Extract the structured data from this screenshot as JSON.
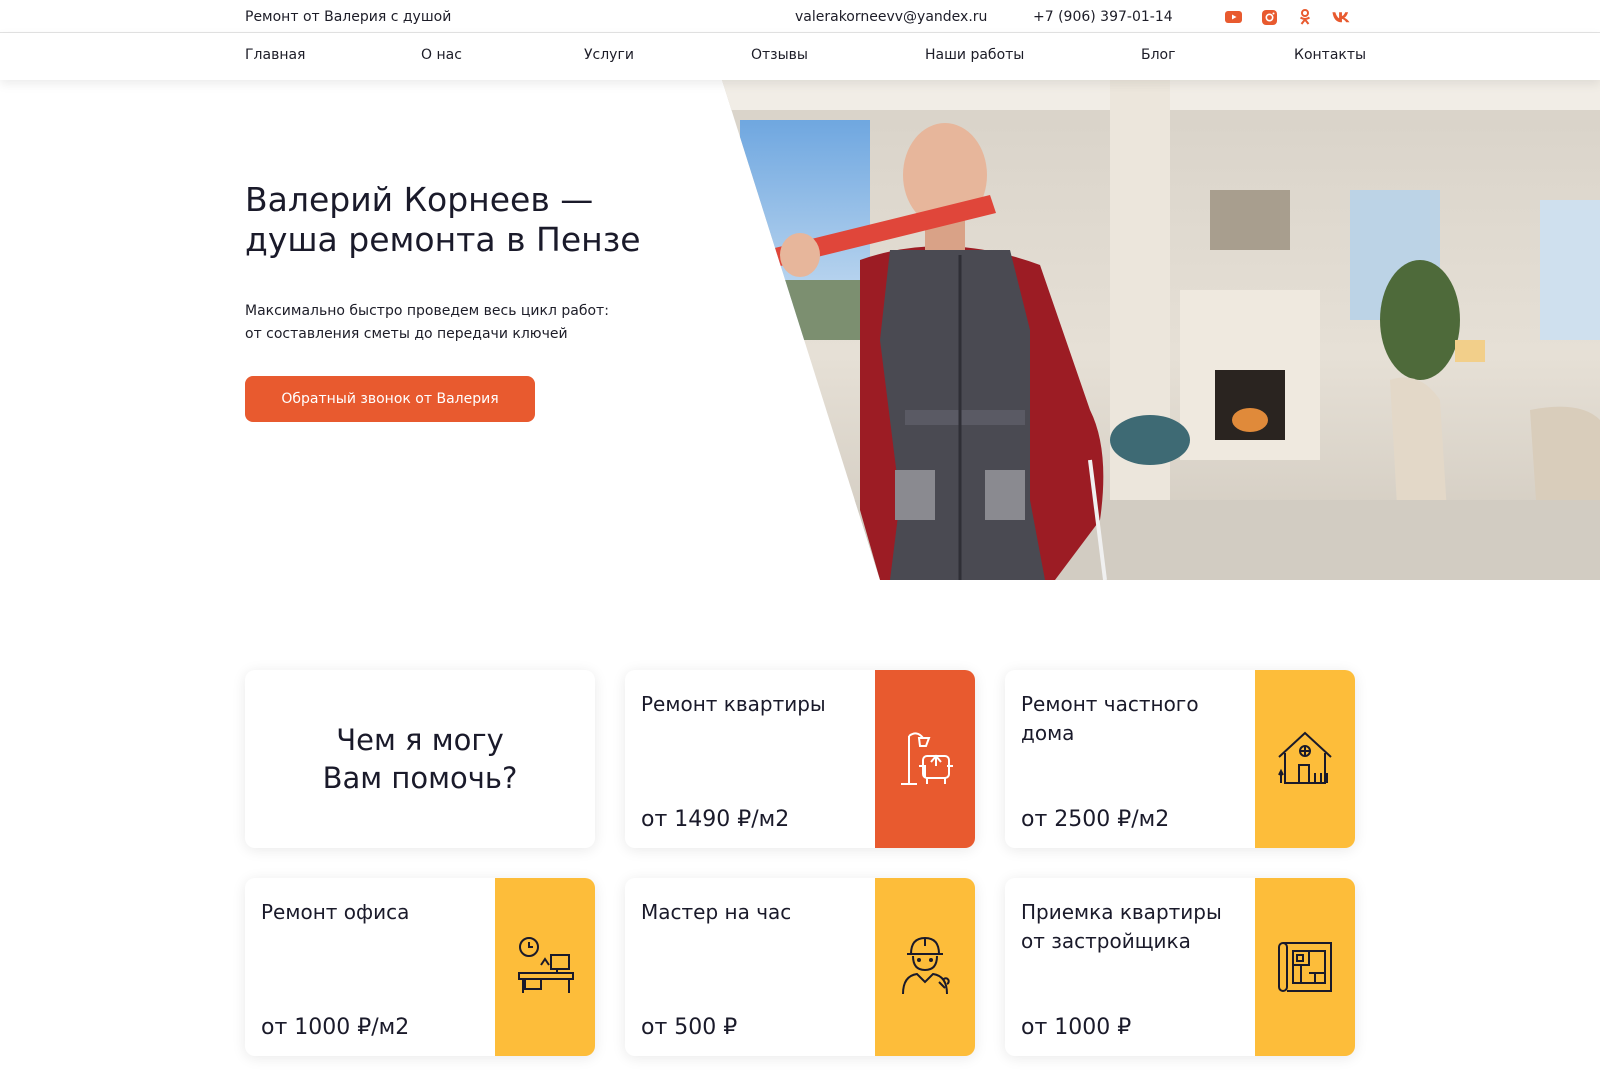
{
  "topbar": {
    "brand": "Ремонт от Валерия с душой",
    "email": "valerakorneevv@yandex.ru",
    "phone": "+7 (906) 397-01-14",
    "socials": [
      "youtube-icon",
      "instagram-icon",
      "odnoklassniki-icon",
      "vk-icon"
    ],
    "social_color": "#e85a2f"
  },
  "nav": {
    "items": [
      "Главная",
      "О нас",
      "Услуги",
      "Отзывы",
      "Наши работы",
      "Блог",
      "Контакты"
    ]
  },
  "hero": {
    "title_line1": "Валерий Корнеев —",
    "title_line2": "душа ремонта в Пензе",
    "sub_line1": "Максимально быстро проведем весь цикл работ:",
    "sub_line2": "от составления сметы до передачи ключей",
    "cta": "Обратный звонок от Валерия"
  },
  "services": {
    "intro_line1": "Чем я могу",
    "intro_line2": "Вам помочь?",
    "cards": [
      {
        "title": "Ремонт квартиры",
        "price": "от 1490 ₽/м2",
        "icon": "armchair-lamp-icon",
        "color": "#e85a2f"
      },
      {
        "title": "Ремонт частного дома",
        "price": "от 2500 ₽/м2",
        "icon": "house-icon",
        "color": "#fdbd3a"
      },
      {
        "title": "Ремонт офиса",
        "price": "от 1000 ₽/м2",
        "icon": "office-desk-icon",
        "color": "#fdbd3a"
      },
      {
        "title": "Мастер на час",
        "price": "от 500 ₽",
        "icon": "worker-icon",
        "color": "#fdbd3a"
      },
      {
        "title": "Приемка квартиры от застройщика",
        "price": "от 1000 ₽",
        "icon": "blueprint-icon",
        "color": "#fdbd3a"
      }
    ]
  }
}
